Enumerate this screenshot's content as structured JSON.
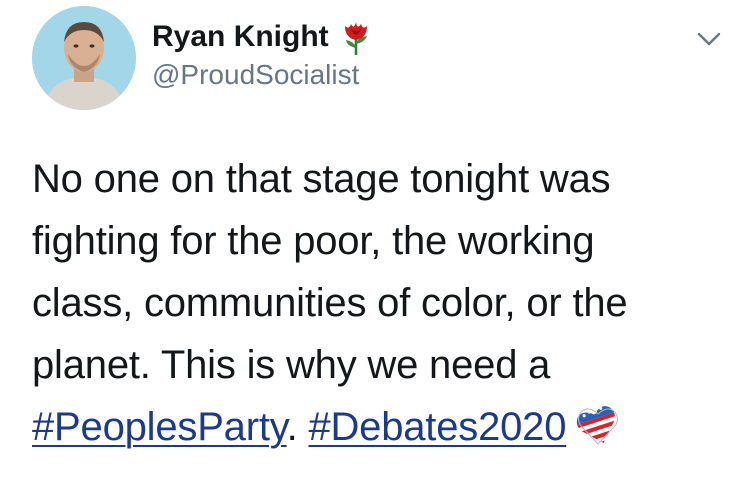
{
  "author": {
    "display_name": "Ryan Knight",
    "handle": "@ProudSocialist",
    "name_emoji": "rose-icon",
    "avatar": "profile-photo"
  },
  "menu": {
    "icon": "chevron-down-icon"
  },
  "tweet": {
    "line1": "No one on that stage tonight was",
    "line2": "fighting for the poor, the working",
    "line3": "class, communities of color, or the",
    "line4_text": "planet. This is why we need a",
    "hashtag1": "#PeoplesParty",
    "separator": ".",
    "hashtag2": "#Debates2020",
    "trailing_emoji": "flag-heart-icon"
  },
  "colors": {
    "text": "#14171a",
    "secondary": "#657786",
    "hashtag": "#1b3a8c"
  }
}
